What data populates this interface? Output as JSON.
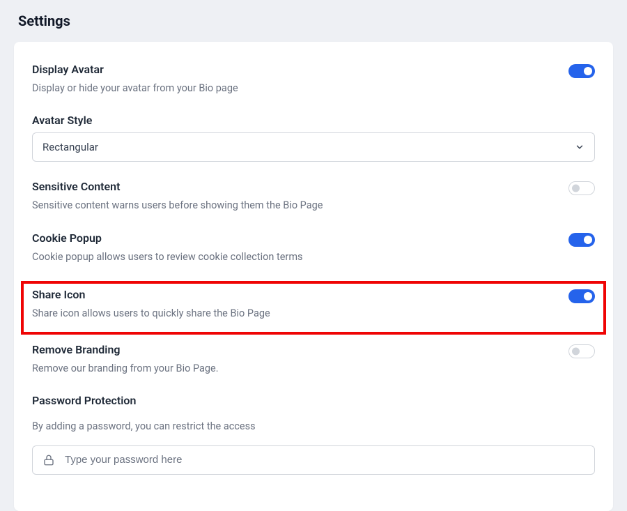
{
  "pageTitle": "Settings",
  "settings": {
    "displayAvatar": {
      "title": "Display Avatar",
      "desc": "Display or hide your avatar from your Bio page"
    },
    "avatarStyle": {
      "title": "Avatar Style",
      "selected": "Rectangular"
    },
    "sensitiveContent": {
      "title": "Sensitive Content",
      "desc": "Sensitive content warns users before showing them the Bio Page"
    },
    "cookiePopup": {
      "title": "Cookie Popup",
      "desc": "Cookie popup allows users to review cookie collection terms"
    },
    "shareIcon": {
      "title": "Share Icon",
      "desc": "Share icon allows users to quickly share the Bio Page"
    },
    "removeBranding": {
      "title": "Remove Branding",
      "desc": "Remove our branding from your Bio Page."
    },
    "passwordProtection": {
      "title": "Password Protection",
      "desc": "By adding a password, you can restrict the access",
      "placeholder": "Type your password here"
    }
  }
}
